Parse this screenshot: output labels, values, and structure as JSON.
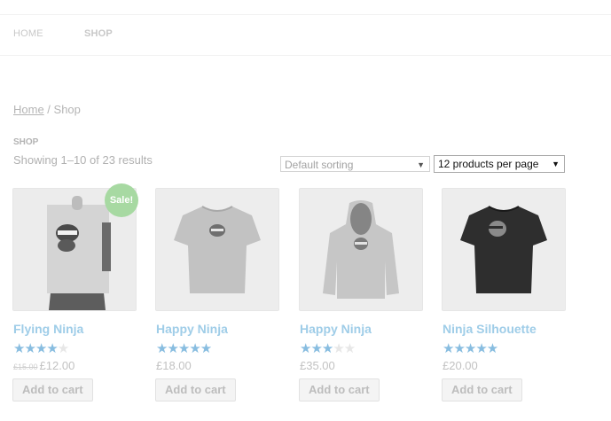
{
  "nav": {
    "items": [
      "HOME",
      "SHOP"
    ]
  },
  "breadcrumb": {
    "home": "Home",
    "separator": " / ",
    "current": "Shop"
  },
  "heading": "SHOP",
  "result_count": "Showing 1–10 of 23 results",
  "sorting": {
    "selected": "Default sorting"
  },
  "per_page": {
    "selected": "12 products per page"
  },
  "colors": {
    "link": "#9fcde8",
    "star": "#88bde0",
    "sale_badge": "#a7d9a2"
  },
  "products": [
    {
      "name": "Flying Ninja",
      "sale_badge": "Sale!",
      "rating": 4,
      "old_price": "£15.00",
      "price": "£12.00",
      "button": "Add to cart",
      "image": "ninja-poster"
    },
    {
      "name": "Happy Ninja",
      "rating": 5,
      "price": "£18.00",
      "button": "Add to cart",
      "image": "grey-tshirt"
    },
    {
      "name": "Happy Ninja",
      "rating": 3,
      "price": "£35.00",
      "button": "Add to cart",
      "image": "grey-hoodie"
    },
    {
      "name": "Ninja Silhouette",
      "rating": 5,
      "price": "£20.00",
      "button": "Add to cart",
      "image": "black-tshirt"
    }
  ]
}
